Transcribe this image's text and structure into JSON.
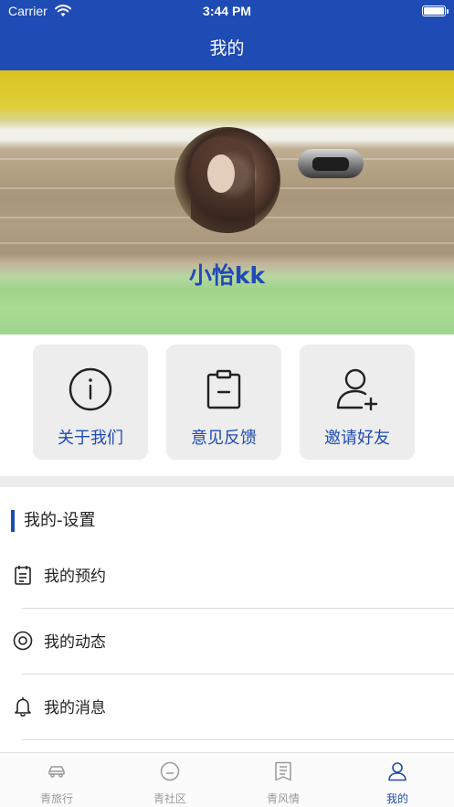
{
  "status_bar": {
    "carrier": "Carrier",
    "time": "3:44 PM"
  },
  "nav": {
    "title": "我的"
  },
  "profile": {
    "username": "小怡kk"
  },
  "actions": [
    {
      "label": "关于我们",
      "icon": "info-icon"
    },
    {
      "label": "意见反馈",
      "icon": "clipboard-icon"
    },
    {
      "label": "邀请好友",
      "icon": "add-user-icon"
    }
  ],
  "settings": {
    "title": "我的-设置",
    "items": [
      {
        "label": "我的预约",
        "icon": "calendar-list-icon"
      },
      {
        "label": "我的动态",
        "icon": "target-circle-icon"
      },
      {
        "label": "我的消息",
        "icon": "bell-icon"
      }
    ]
  },
  "tabs": [
    {
      "label": "青旅行",
      "icon": "car-icon",
      "active": false
    },
    {
      "label": "青社区",
      "icon": "smile-icon",
      "active": false
    },
    {
      "label": "青风情",
      "icon": "document-icon",
      "active": false
    },
    {
      "label": "我的",
      "icon": "user-icon",
      "active": true
    }
  ],
  "colors": {
    "primary": "#1f4bb5",
    "card_bg": "#ededed",
    "tab_inactive": "#9a9a9a"
  }
}
